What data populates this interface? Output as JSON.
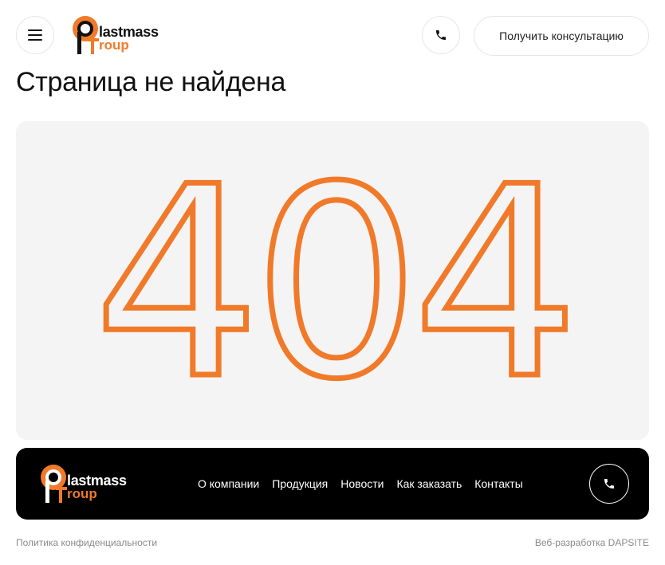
{
  "header": {
    "menu_icon": "hamburger-menu-icon",
    "logo_line1": "lastmass",
    "logo_line2": "roup",
    "phone_icon": "phone-icon",
    "consult_label": "Получить консультацию"
  },
  "page": {
    "title": "Страница не найдена",
    "error_code": "404"
  },
  "footer": {
    "logo_line1": "lastmass",
    "logo_line2": "roup",
    "nav": [
      "О компании",
      "Продукция",
      "Новости",
      "Как заказать",
      "Контакты"
    ],
    "phone_icon": "phone-icon"
  },
  "bottom": {
    "privacy": "Политика конфиденциальности",
    "developer": "Веб-разработка DAPSITE"
  },
  "colors": {
    "accent": "#f07a2a",
    "hero_bg": "#f4f4f4",
    "footer_bg": "#000000"
  }
}
